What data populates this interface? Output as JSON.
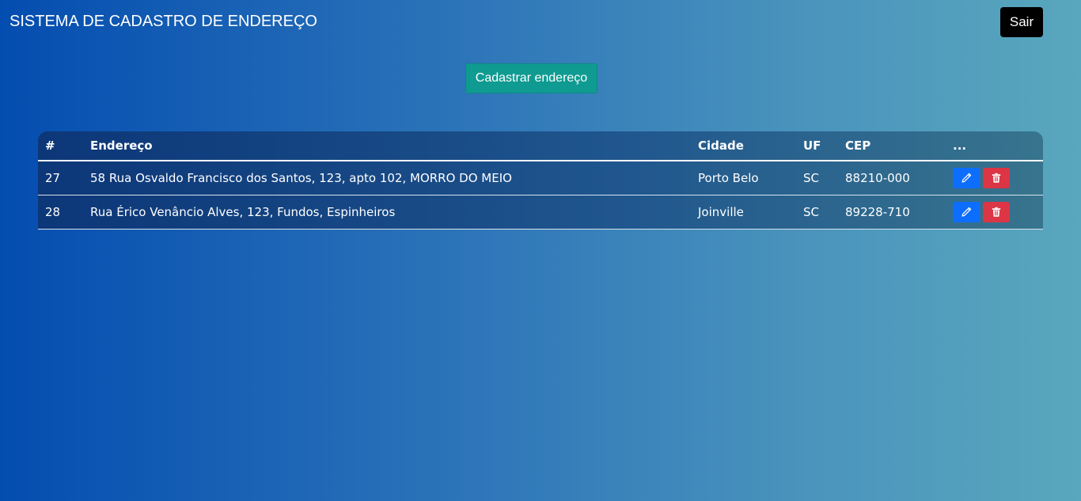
{
  "header": {
    "title": "SISTEMA DE CADASTRO DE ENDEREÇO",
    "logout_label": "Sair"
  },
  "actions": {
    "register_label": "Cadastrar endereço"
  },
  "table": {
    "columns": [
      "#",
      "Endereço",
      "Cidade",
      "UF",
      "CEP",
      "..."
    ],
    "rows": [
      {
        "id": "27",
        "endereco": "58 Rua Osvaldo Francisco dos Santos, 123, apto 102, MORRO DO MEIO",
        "cidade": "Porto Belo",
        "uf": "SC",
        "cep": "88210-000",
        "edit_icon": "pencil-icon",
        "delete_icon": "trash-icon"
      },
      {
        "id": "28",
        "endereco": "Rua Érico Venâncio Alves, 123, Fundos, Espinheiros",
        "cidade": "Joinville",
        "uf": "SC",
        "cep": "89228-710",
        "edit_icon": "pencil-icon",
        "delete_icon": "trash-icon"
      }
    ]
  },
  "colors": {
    "edit_button": "#0d6efd",
    "delete_button": "#dc3545",
    "register_button": "#0f9b91",
    "logout_button": "#000000"
  }
}
